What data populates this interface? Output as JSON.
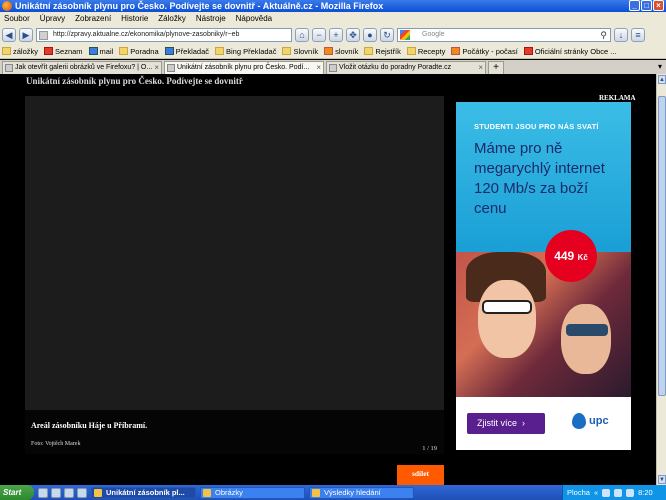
{
  "window": {
    "title": "Unikátní zásobník plynu pro Česko. Podívejte se dovnitř - Aktuálně.cz - Mozilla Firefox",
    "buttons": [
      "_",
      "□",
      "×"
    ]
  },
  "menu": [
    "Soubor",
    "Úpravy",
    "Zobrazení",
    "Historie",
    "Záložky",
    "Nástroje",
    "Nápověda"
  ],
  "nav": {
    "url": "http://zpravy.aktualne.cz/ekonomika/plynove-zasobniky/r~eb",
    "search_placeholder": "Google"
  },
  "bookmarks": [
    {
      "label": "záložky",
      "icon": "folder-icon"
    },
    {
      "label": "Seznam",
      "icon": "seznam-icon"
    },
    {
      "label": "mail",
      "icon": "mail-icon"
    },
    {
      "label": "Poradna",
      "icon": "folder-icon"
    },
    {
      "label": "Překladač",
      "icon": "translate-icon"
    },
    {
      "label": "Bing Překladač",
      "icon": "folder-icon"
    },
    {
      "label": "Slovník",
      "icon": "folder-icon"
    },
    {
      "label": "slovník",
      "icon": "dictionary-icon"
    },
    {
      "label": "Rejstřík",
      "icon": "folder-icon"
    },
    {
      "label": "Recepty",
      "icon": "folder-icon"
    },
    {
      "label": "Počátky - počasí",
      "icon": "weather-icon"
    },
    {
      "label": "Oficiální stránky Obce ...",
      "icon": "shield-icon"
    }
  ],
  "tabs": [
    {
      "label": "Jak otevřít galerii obrázků ve Firefoxu? | O...",
      "active": false
    },
    {
      "label": "Unikátní zásobník plynu pro Česko. Podí...",
      "active": true
    },
    {
      "label": "Vložit otázku do poradny Poradte.cz",
      "active": false
    }
  ],
  "page": {
    "heading": "Unikátní zásobník plynu pro Česko. Podívejte se dovnitř",
    "ad_label": "REKLAMA",
    "gallery": {
      "caption": "Areál zásobníku Háje u Příbramí.",
      "credit": "Foto: Vojtěch Marek",
      "counter": "1 / 19"
    },
    "share_label": "sdílet"
  },
  "ad": {
    "eyebrow": "STUDENTI JSOU PRO NÁS SVATÍ",
    "headline": "Máme pro ně megarychlý internet 120 Mb/s za boží cenu",
    "price_value": "449",
    "price_unit": "Kč",
    "cta": "Zjistit více",
    "cta_arrow": "›",
    "brand": "upc"
  },
  "taskbar": {
    "start": "Start",
    "tasks": [
      {
        "label": "Unikátní zásobník pl...",
        "active": true
      },
      {
        "label": "Obrázky",
        "active": false
      },
      {
        "label": "Výsledky hledání",
        "active": false
      }
    ],
    "tray_label": "Plocha",
    "time": "8:20"
  }
}
